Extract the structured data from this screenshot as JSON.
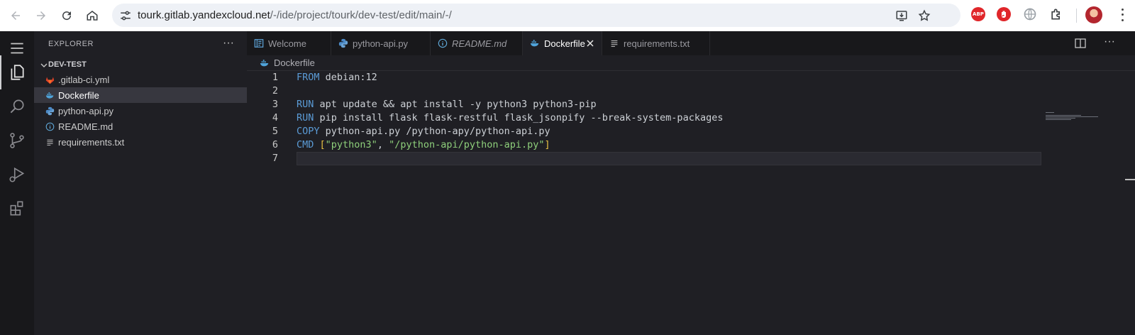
{
  "browser": {
    "url_host": "tourk.gitlab.yandexcloud.net",
    "url_path": "/-/ide/project/tourk/dev-test/edit/main/-/",
    "extensions": {
      "abp_label": "ABP"
    }
  },
  "ide": {
    "sidebar": {
      "title": "EXPLORER",
      "more": "···",
      "folder": "DEV-TEST",
      "files": [
        {
          "name": ".gitlab-ci.yml",
          "icon": "gitlab-icon"
        },
        {
          "name": "Dockerfile",
          "icon": "docker-icon",
          "selected": true
        },
        {
          "name": "python-api.py",
          "icon": "python-icon"
        },
        {
          "name": "README.md",
          "icon": "info-icon"
        },
        {
          "name": "requirements.txt",
          "icon": "lines-icon"
        }
      ]
    },
    "tabs": [
      {
        "label": "Welcome",
        "icon": "welcome-icon"
      },
      {
        "label": "python-api.py",
        "icon": "python-icon"
      },
      {
        "label": "README.md",
        "icon": "info-icon",
        "italic": true
      },
      {
        "label": "Dockerfile",
        "icon": "docker-icon",
        "active": true
      },
      {
        "label": "requirements.txt",
        "icon": "lines-icon"
      }
    ],
    "more_actions": "···",
    "breadcrumb": "Dockerfile",
    "code_lines": [
      {
        "n": "1",
        "kw": "FROM",
        "rest": " debian:12"
      },
      {
        "n": "2"
      },
      {
        "n": "3",
        "kw": "RUN",
        "rest": " apt update && apt install -y python3 python3-pip"
      },
      {
        "n": "4",
        "kw": "RUN",
        "rest": " pip install flask flask-restful flask_jsonpify --break-system-packages"
      },
      {
        "n": "5",
        "kw": "COPY",
        "rest": " python-api.py /python-apy/python-api.py"
      },
      {
        "n": "6",
        "kw": "CMD",
        "b1": " [",
        "s1": "\"python3\"",
        "mid": ", ",
        "s2": "\"/python-api/python-api.py\"",
        "b2": "]"
      },
      {
        "n": "7"
      }
    ]
  },
  "colors": {
    "keyword": "#5b9bd6",
    "string": "#8ecf7b",
    "bracket": "#e8c142",
    "editor_bg": "#1f1f24"
  }
}
